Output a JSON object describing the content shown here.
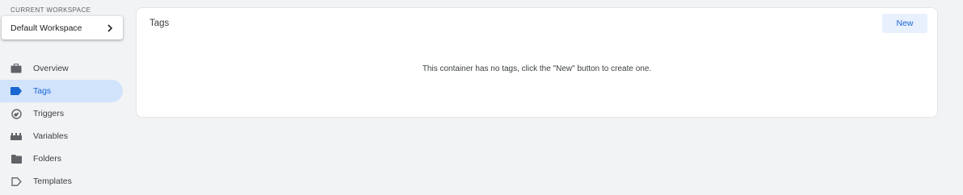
{
  "workspace": {
    "caption": "CURRENT WORKSPACE",
    "name": "Default Workspace"
  },
  "nav": {
    "items": [
      {
        "label": "Overview",
        "icon": "briefcase-icon"
      },
      {
        "label": "Tags",
        "icon": "tag-icon",
        "active": true
      },
      {
        "label": "Triggers",
        "icon": "trigger-icon"
      },
      {
        "label": "Variables",
        "icon": "variables-icon"
      },
      {
        "label": "Folders",
        "icon": "folder-icon"
      },
      {
        "label": "Templates",
        "icon": "template-icon"
      }
    ]
  },
  "panel": {
    "title": "Tags",
    "new_label": "New",
    "empty_message": "This container has no tags, click the \"New\" button to create one."
  },
  "colors": {
    "accent": "#1967d2",
    "active_bg": "#d2e3fc",
    "page_bg": "#f1f3f4"
  }
}
